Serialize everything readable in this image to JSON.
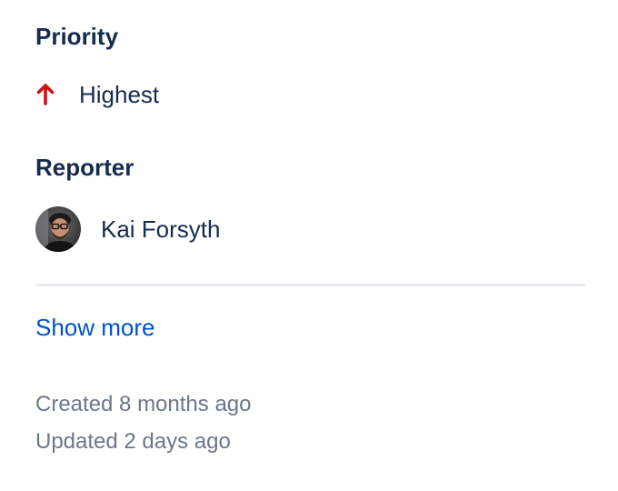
{
  "priority": {
    "heading": "Priority",
    "value": "Highest",
    "icon": "arrow-up-icon",
    "icon_color": "#cd1317"
  },
  "reporter": {
    "heading": "Reporter",
    "name": "Kai Forsyth",
    "avatar": "user-avatar"
  },
  "show_more": {
    "label": "Show more",
    "color": "#0052cc"
  },
  "meta": {
    "created": "Created 8 months ago",
    "updated": "Updated 2 days ago"
  },
  "colors": {
    "heading": "#172b4d",
    "text": "#172b4d",
    "muted": "#6b778c",
    "divider": "#ebecf0"
  }
}
